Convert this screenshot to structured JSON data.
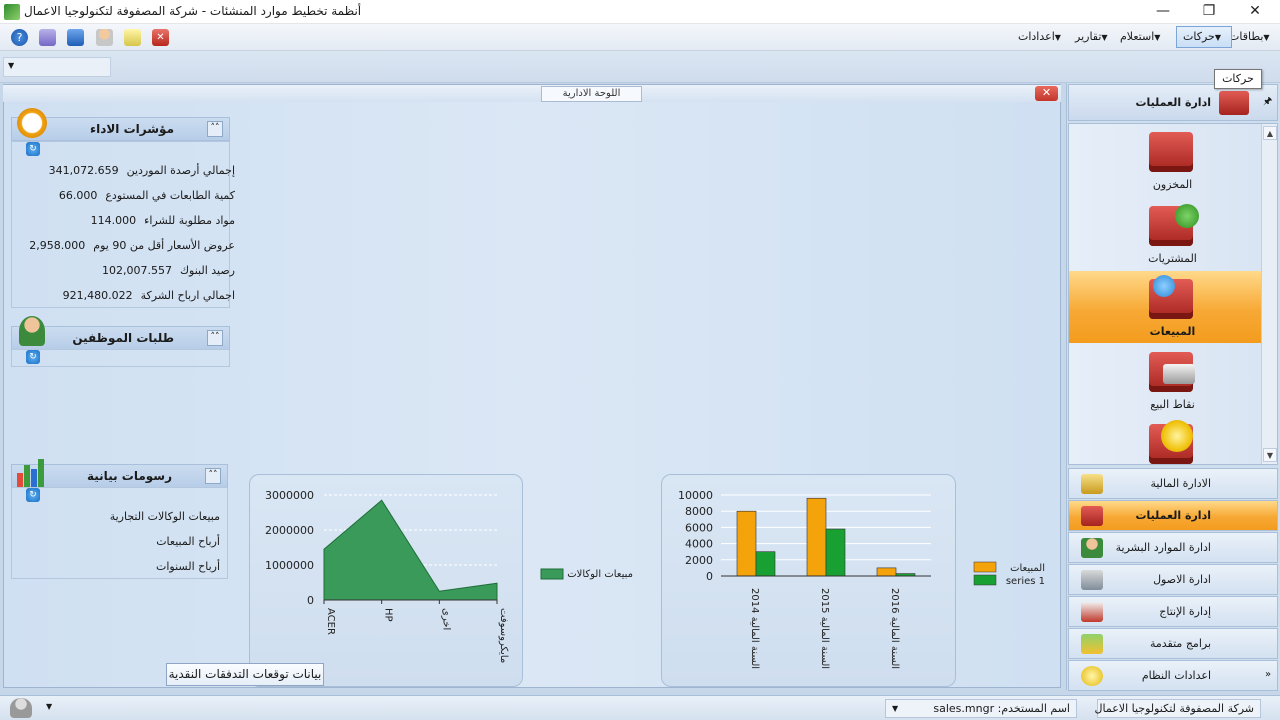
{
  "window": {
    "title": "أنظمة تخطيط موارد المنشئات - شركة المصفوفة لتكنولوجيا الاعمال",
    "minimize_icon": "minimize-icon",
    "maximize_icon": "restore-icon",
    "close_icon": "close-icon"
  },
  "menu": {
    "items": [
      "بطاقات",
      "حركات",
      "استعلام",
      "تقارير",
      "اعدادات"
    ]
  },
  "tooltip": "حركات",
  "dashboard": {
    "tab_label": "اللوحة الادارية",
    "kpi_panel": {
      "title": "مؤشرات الاداء",
      "rows": [
        {
          "label": "إجمالي أرصدة الموردين",
          "value": "341,072.659"
        },
        {
          "label": "كمية الطابعات في المستودع",
          "value": "66.000"
        },
        {
          "label": "مواد مطلوبة للشراء",
          "value": "114.000"
        },
        {
          "label": "عروض الأسعار أقل من 90 يوم",
          "value": "2,958.000"
        },
        {
          "label": "رصيد البنوك",
          "value": "102,007.557"
        },
        {
          "label": "اجمالي ارباح الشركة",
          "value": "921,480.022"
        }
      ]
    },
    "employees_panel": {
      "title": "طلبات الموظفين"
    },
    "charts_panel": {
      "title": "رسومات بيانية",
      "items": [
        "مبيعات الوكالات التجارية",
        "أرباح المبيعات",
        "أرباح السنوات"
      ]
    },
    "cashflow_button": "بيانات توقعات التدفقات النقدية"
  },
  "chart_data": [
    {
      "type": "area",
      "categories": [
        "ACER",
        "HP",
        "اخرى",
        "مايكروسوفت"
      ],
      "series": [
        {
          "name": "مبيعات الوكالات",
          "values": [
            1450000,
            2850000,
            250000,
            480000
          ]
        }
      ],
      "ylim": [
        0,
        3000000
      ],
      "yticks": [
        "3000000",
        "2000000",
        "1000000",
        "0"
      ],
      "color": "#3a9a5a",
      "legend_position": "right"
    },
    {
      "type": "bar",
      "categories": [
        "السنة المالية 2014",
        "السنة المالية 2015",
        "السنة المالية 2016"
      ],
      "series": [
        {
          "name": "المبيعات",
          "values": [
            8000,
            9600,
            1000
          ],
          "color": "#f5a30a"
        },
        {
          "name": "series 1",
          "values": [
            3000,
            5800,
            300
          ],
          "color": "#18a032"
        }
      ],
      "ylim": [
        0,
        10000
      ],
      "yticks": [
        "10000",
        "8000",
        "6000",
        "4000",
        "2000",
        "0"
      ],
      "legend_position": "right"
    }
  ],
  "nav": {
    "header": "ادارة العمليات",
    "big_items": [
      {
        "label": "المخزون",
        "active": false
      },
      {
        "label": "المشتريات",
        "active": false
      },
      {
        "label": "المبيعات",
        "active": true
      },
      {
        "label": "نقاط البيع",
        "active": false
      },
      {
        "label": "",
        "active": false
      }
    ],
    "modules": [
      {
        "label": "الادارة المالية",
        "icon": "coins-icon",
        "active": false
      },
      {
        "label": "ادارة العمليات",
        "icon": "boxes-icon",
        "active": true
      },
      {
        "label": "ادارة الموارد البشرية",
        "icon": "users-icon",
        "active": false
      },
      {
        "label": "ادارة الاصول",
        "icon": "assets-icon",
        "active": false
      },
      {
        "label": "إدارة الإنتاج",
        "icon": "factory-icon",
        "active": false
      },
      {
        "label": "برامج متقدمة",
        "icon": "advanced-icon",
        "active": false
      },
      {
        "label": "اعدادات النظام",
        "icon": "settings-icon",
        "active": false
      }
    ]
  },
  "status": {
    "company": "شركة المصفوفة لتكنولوجيا الاعمال",
    "user_label": "اسم المستخدم:",
    "user": "sales.mngr"
  }
}
